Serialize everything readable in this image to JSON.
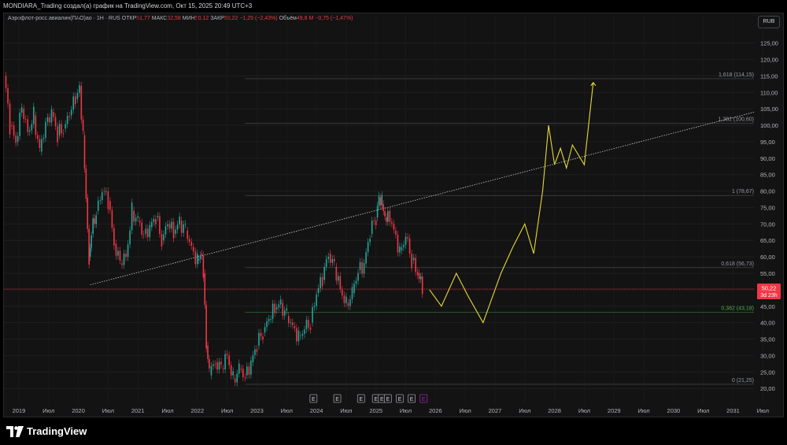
{
  "header": {
    "attribution": "MONDIARA_Trading создал(а) график на TradingView.com, Окт 15, 2025 20:49 UTC+3"
  },
  "legend": {
    "symbol": "Аэрофлот-росс.авиалин(ПАО)ао · 1Н · RUS",
    "open_label": "ОТКР",
    "open": "51,77",
    "high_label": "МАКС",
    "high": "52,58",
    "low_label": "МИН",
    "low": "50,12",
    "close_label": "ЗАКР",
    "close": "50,22",
    "change": "−1,25 (−2,43%)",
    "volume_label": "Объём",
    "volume": "49,8 М",
    "volume_change": "−0,75 (−1,47%)"
  },
  "currency": "RUB",
  "price_badge": {
    "price": "50,22",
    "countdown": "3d 23h"
  },
  "brand": "TradingView",
  "colors": {
    "up": "#26a69a",
    "down": "#f23645",
    "forecast": "#e8d83a",
    "fib_line": "#5d606b",
    "fib_green": "#4caf50",
    "trendline": "#c8c8c8",
    "earnings_purple": "#9c27b0",
    "current_price": "#f23645"
  },
  "icons": [
    "tradingview-logo-icon"
  ],
  "chart_data": {
    "type": "line",
    "title": "",
    "x_axis": {
      "ticks": [
        "2019",
        "Июл",
        "2020",
        "Июл",
        "2021",
        "Июл",
        "2022",
        "Июл",
        "2023",
        "Июл",
        "2024",
        "Июл",
        "2025",
        "Июл",
        "2026",
        "Июл",
        "2027",
        "Июл",
        "2028",
        "Июл",
        "2029",
        "Июл",
        "2030",
        "Июл",
        "2031",
        "Июл"
      ],
      "range": [
        2018.75,
        2031.35
      ]
    },
    "y_axis": {
      "ticks": [
        "20,00",
        "25,00",
        "30,00",
        "35,00",
        "40,00",
        "45,00",
        "50,00",
        "55,00",
        "60,00",
        "65,00",
        "70,00",
        "75,00",
        "80,00",
        "85,00",
        "90,00",
        "95,00",
        "100,00",
        "105,00",
        "110,00",
        "115,00",
        "120,00",
        "125,00"
      ],
      "range": [
        15.5,
        128.5
      ],
      "side": "right"
    },
    "grid": true,
    "price_series": {
      "name": "",
      "x": [
        2018.75,
        2018.85,
        2018.95,
        2019.05,
        2019.15,
        2019.25,
        2019.35,
        2019.45,
        2019.55,
        2019.65,
        2019.75,
        2019.85,
        2019.95,
        2020.02,
        2020.08,
        2020.13,
        2020.18,
        2020.22,
        2020.3,
        2020.4,
        2020.5,
        2020.6,
        2020.7,
        2020.8,
        2020.9,
        2021.0,
        2021.1,
        2021.2,
        2021.3,
        2021.4,
        2021.5,
        2021.6,
        2021.7,
        2021.8,
        2021.9,
        2022.0,
        2022.05,
        2022.1,
        2022.15,
        2022.2,
        2022.3,
        2022.4,
        2022.5,
        2022.6,
        2022.7,
        2022.8,
        2022.9,
        2023.0,
        2023.1,
        2023.2,
        2023.3,
        2023.4,
        2023.5,
        2023.6,
        2023.7,
        2023.8,
        2023.9,
        2024.0,
        2024.1,
        2024.2,
        2024.3,
        2024.4,
        2024.5,
        2024.6,
        2024.7,
        2024.8,
        2024.9,
        2025.0,
        2025.05,
        2025.1,
        2025.15,
        2025.2,
        2025.3,
        2025.4,
        2025.5,
        2025.6,
        2025.7,
        2025.78
      ],
      "y": [
        115,
        100,
        95,
        105,
        98,
        103,
        92,
        101,
        104,
        97,
        99,
        103,
        108,
        112,
        97,
        78,
        60,
        67,
        74,
        80,
        77,
        64,
        58,
        60,
        74,
        71,
        67,
        69,
        72,
        65,
        70,
        67,
        71,
        68,
        63,
        59,
        61,
        55,
        33,
        24,
        28,
        26,
        30,
        23,
        26,
        24,
        28,
        33,
        37,
        41,
        44,
        46,
        42,
        39,
        36,
        38,
        40,
        49,
        53,
        61,
        57,
        50,
        46,
        49,
        56,
        58,
        67,
        72,
        78,
        76,
        72,
        74,
        68,
        62,
        66,
        59,
        55,
        50.22
      ],
      "color": "mixed"
    },
    "forecast_path": {
      "name": "",
      "x": [
        2025.9,
        2026.1,
        2026.35,
        2026.55,
        2026.8,
        2027.1,
        2027.3,
        2027.5,
        2027.65,
        2027.8,
        2027.9,
        2028.0,
        2028.1,
        2028.2,
        2028.3,
        2028.5,
        2028.65
      ],
      "y": [
        50,
        45,
        55,
        48,
        40,
        55,
        63,
        70,
        61,
        80,
        100,
        88,
        93,
        87,
        94,
        88,
        113
      ],
      "color": "#e8d83a"
    },
    "fibonacci_levels": [
      {
        "level": "1,618",
        "value": 114.15,
        "label": "1,618 (114,15)"
      },
      {
        "level": "1,382",
        "value": 100.6,
        "label": "1,382 (100,60)"
      },
      {
        "level": "1",
        "value": 78.67,
        "label": "1 (78,67)"
      },
      {
        "level": "0,618",
        "value": 56.73,
        "label": "0,618 (56,73)"
      },
      {
        "level": "0,382",
        "value": 43.18,
        "label": "0,382 (43,18)"
      },
      {
        "level": "0",
        "value": 21.25,
        "label": "0 (21,25)"
      }
    ],
    "trendline": {
      "x": [
        2020.2,
        2031.35
      ],
      "y": [
        51.5,
        104.0
      ]
    },
    "current_price_line": 50.22,
    "earnings_markers": {
      "label": "E",
      "x": [
        2023.95,
        2024.35,
        2024.75,
        2025.0,
        2025.1,
        2025.2,
        2025.4,
        2025.6,
        2025.8
      ],
      "highlighted_index": 8
    }
  }
}
